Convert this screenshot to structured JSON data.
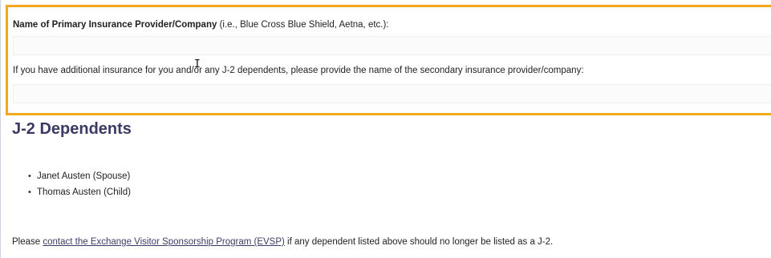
{
  "insurance": {
    "primary_label_bold": "Name of Primary Insurance Provider/Company",
    "primary_label_hint": " (i.e., Blue Cross Blue Shield, Aetna, etc.):",
    "primary_value": "",
    "secondary_label": "If you have additional insurance for you and/or any J-2 dependents, please provide the name of the secondary insurance provider/company:",
    "secondary_value": "",
    "highlight_color": "#f2a81d"
  },
  "dependents": {
    "heading": "J-2 Dependents",
    "items": [
      "Janet Austen (Spouse)",
      "Thomas Austen (Child)"
    ]
  },
  "footer": {
    "prefix": "Please ",
    "link_text": "contact the Exchange Visitor Sponsorship Program (EVSP)",
    "suffix": " if any dependent listed above should no longer be listed as a J-2."
  },
  "cursor": {
    "icon": "text-cursor-icon",
    "glyph": "I"
  }
}
